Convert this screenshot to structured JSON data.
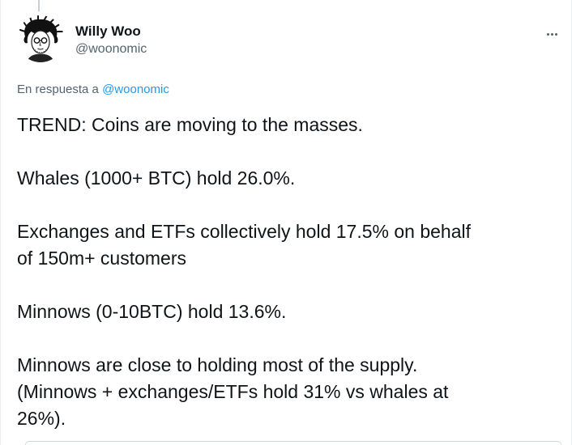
{
  "tweet": {
    "author": {
      "display_name": "Willy Woo",
      "handle": "@woonomic"
    },
    "reply_context": {
      "prefix": "En respuesta a",
      "mention": "@woonomic"
    },
    "text": {
      "p1": "TREND: Coins are moving to the masses.",
      "p2": "Whales (1000+ BTC) hold 26.0%.",
      "p3_line1": "Exchanges and ETFs collectively hold 17.5% on behalf",
      "p3_line2": "of 150m+ customers",
      "p4": "Minnows (0-10BTC) hold 13.6%.",
      "p5_line1": "Minnows are close to holding most of the supply.",
      "p5_line2": "(Minnows + exchanges/ETFs hold 31% vs whales at",
      "p5_line3": "26%)."
    },
    "icons": {
      "more": "more-horizontal-icon",
      "avatar": "sketch-portrait-avatar"
    },
    "colors": {
      "link": "#1d9bf0",
      "secondary_text": "#536471",
      "primary_text": "#0f1419"
    }
  }
}
